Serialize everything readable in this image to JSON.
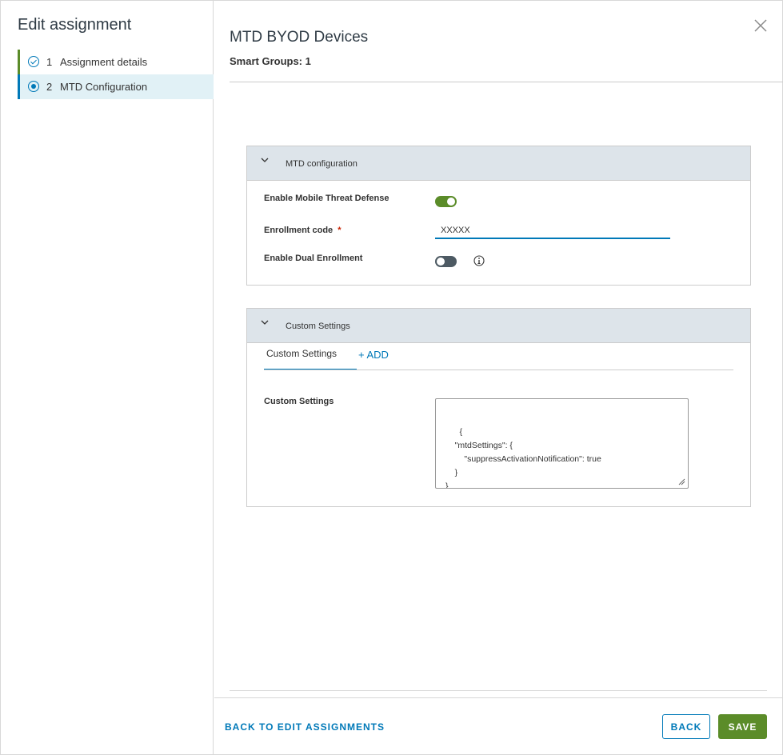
{
  "sidebar": {
    "title": "Edit assignment",
    "steps": [
      {
        "number": "1",
        "label": "Assignment details",
        "status": "completed"
      },
      {
        "number": "2",
        "label": "MTD Configuration",
        "status": "current"
      }
    ]
  },
  "header": {
    "title": "MTD BYOD Devices",
    "subtitle": "Smart Groups: 1"
  },
  "mtd_panel": {
    "title": "MTD configuration",
    "enable_mtd_label": "Enable Mobile Threat Defense",
    "enable_mtd_on": true,
    "enrollment_code_label": "Enrollment code",
    "required_marker": "*",
    "enrollment_code_value": "XXXXX",
    "dual_enrollment_label": "Enable Dual Enrollment",
    "dual_enrollment_on": false
  },
  "custom_panel": {
    "title": "Custom Settings",
    "tab_active": "Custom Settings",
    "tab_add": "+ ADD",
    "field_label": "Custom Settings",
    "json_value": "{\n    \"mtdSettings\": {\n        \"suppressActivationNotification\": true\n    }\n}"
  },
  "footer": {
    "back_to_assignments": "BACK TO EDIT ASSIGNMENTS",
    "back": "BACK",
    "save": "SAVE"
  },
  "colors": {
    "accent_blue": "#0079b8",
    "success_green": "#5b8c29",
    "panel_header_bg": "#dde4ea",
    "selected_step_bg": "#e1f1f6"
  },
  "icons": [
    "check-circle-icon",
    "dot-circle-icon",
    "close-icon",
    "chevron-down-icon",
    "info-icon",
    "resize-handle-icon"
  ]
}
